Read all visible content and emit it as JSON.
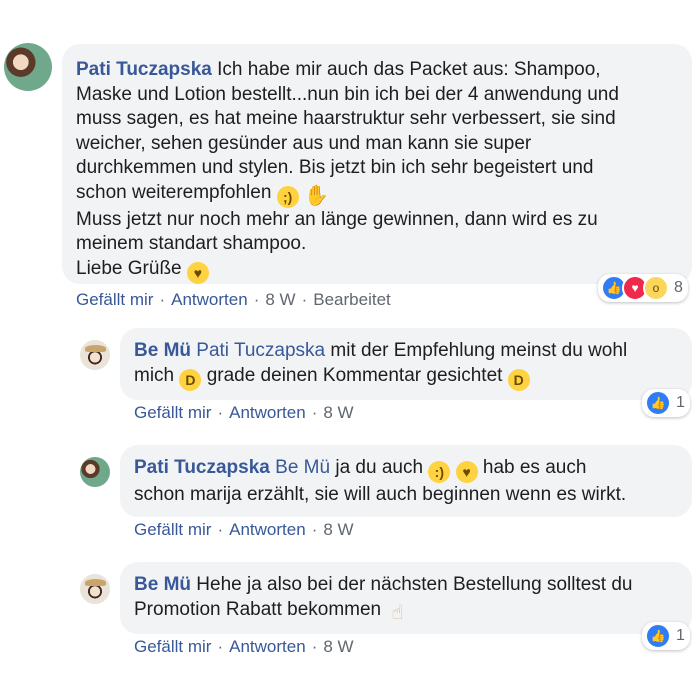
{
  "actions": {
    "like": "Gefällt mir",
    "reply": "Antworten",
    "separator": "·",
    "edited": "Bearbeitet"
  },
  "comments": [
    {
      "author": "Pati Tuczapska",
      "lines": [
        "Ich habe mir auch das Packet aus: Shampoo,",
        "Maske und Lotion bestellt...nun bin ich bei der 4 anwendung und",
        "muss sagen, es hat meine haarstruktur sehr verbessert, sie sind",
        "weicher, sehen gesünder aus und man kann sie super",
        "durchkemmen und stylen. Bis jetzt bin ich sehr begeistert und",
        "schon weiterempfohlen",
        "Muss jetzt nur noch mehr an länge gewinnen, dann wird es zu",
        "meinem standart shampoo.",
        "Liebe Grüße"
      ],
      "emojis": [
        "wink-emoji",
        "ok-hand-emoji",
        "kiss-emoji"
      ],
      "time": "8 W",
      "reactions": {
        "icons": [
          "like-reaction",
          "love-reaction",
          "wow-reaction"
        ],
        "count": "8"
      }
    },
    {
      "author": "Be Mü",
      "mention": "Pati Tuczapska",
      "text_1": "mit der Empfehlung meinst du wohl",
      "text_2a": "mich",
      "text_2b": "grade deinen Kommentar gesichtet",
      "emojis": [
        "tears-of-joy-emoji",
        "grin-emoji"
      ],
      "time": "8 W",
      "reactions": {
        "icons": [
          "like-reaction"
        ],
        "count": "1"
      }
    },
    {
      "author": "Pati Tuczapska",
      "mention": "Be Mü",
      "text_1": "ja du auch",
      "text_1b": "hab es auch",
      "text_2": "schon marija erzählt, sie will auch beginnen wenn es wirkt.",
      "emojis": [
        "smile-emoji",
        "kiss-emoji"
      ],
      "time": "8 W"
    },
    {
      "author": "Be Mü",
      "text_1": "Hehe ja also bei der nächsten Bestellung solltest du",
      "text_2": "Promotion Rabatt bekommen",
      "emojis": [
        "pointing-up-emoji"
      ],
      "time": "8 W",
      "reactions": {
        "icons": [
          "like-reaction"
        ],
        "count": "1"
      }
    }
  ],
  "colors": {
    "name": "#385898",
    "bubble": "#f2f3f5",
    "meta": "#606770",
    "like": "#2e7cf6",
    "love": "#f0284a",
    "wow": "#fcd65a"
  }
}
